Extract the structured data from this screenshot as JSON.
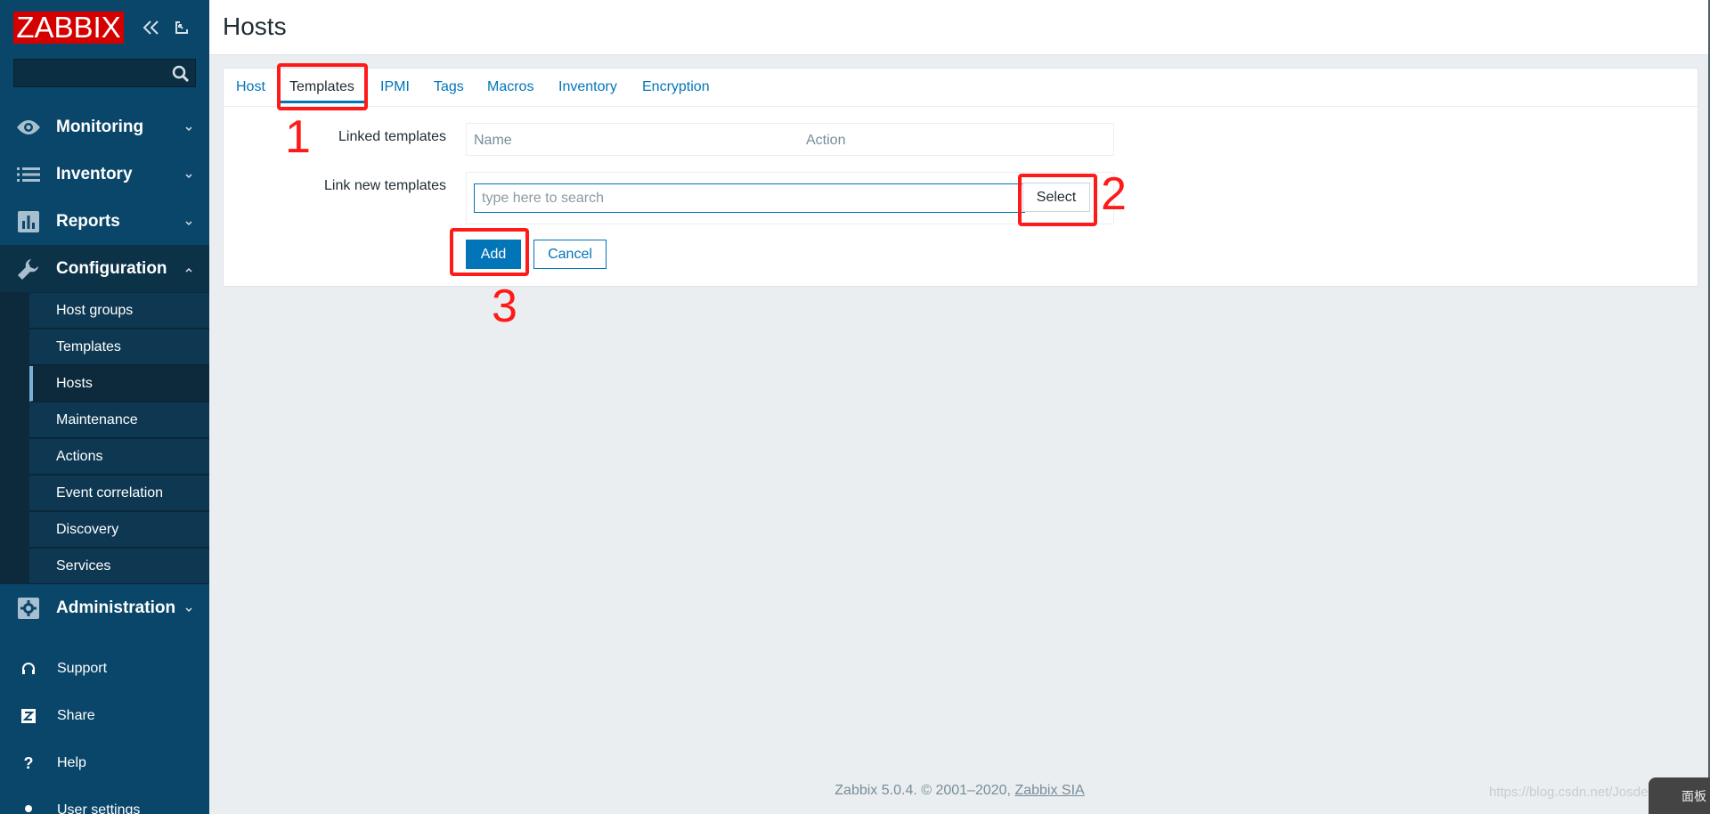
{
  "brand": {
    "logo": "ZABBIX",
    "color": "#d40000"
  },
  "sidebar": {
    "search_value": "",
    "menu": [
      {
        "label": "Monitoring",
        "icon": "eye-icon",
        "expanded": false
      },
      {
        "label": "Inventory",
        "icon": "list-icon",
        "expanded": false
      },
      {
        "label": "Reports",
        "icon": "bar-chart-icon",
        "expanded": false
      },
      {
        "label": "Configuration",
        "icon": "wrench-icon",
        "expanded": true
      },
      {
        "label": "Administration",
        "icon": "gear-icon",
        "expanded": false
      }
    ],
    "config_items": [
      {
        "label": "Host groups"
      },
      {
        "label": "Templates"
      },
      {
        "label": "Hosts",
        "active": true
      },
      {
        "label": "Maintenance"
      },
      {
        "label": "Actions"
      },
      {
        "label": "Event correlation"
      },
      {
        "label": "Discovery"
      },
      {
        "label": "Services"
      }
    ],
    "utility": [
      {
        "label": "Support",
        "icon": "headset-icon"
      },
      {
        "label": "Share",
        "icon": "share-z-icon"
      },
      {
        "label": "Help",
        "icon": "help-icon"
      },
      {
        "label": "User settings",
        "icon": "user-icon"
      }
    ]
  },
  "page": {
    "title": "Hosts"
  },
  "tabs": [
    {
      "label": "Host"
    },
    {
      "label": "Templates",
      "active": true
    },
    {
      "label": "IPMI"
    },
    {
      "label": "Tags"
    },
    {
      "label": "Macros"
    },
    {
      "label": "Inventory"
    },
    {
      "label": "Encryption"
    }
  ],
  "form": {
    "linked_templates_label": "Linked templates",
    "linked_columns": [
      "Name",
      "Action"
    ],
    "link_new_label": "Link new templates",
    "search_placeholder": "type here to search",
    "select_label": "Select",
    "add_label": "Add",
    "cancel_label": "Cancel"
  },
  "annotations": {
    "one": "1",
    "two": "2",
    "three": "3"
  },
  "footer": {
    "text": "Zabbix 5.0.4. © 2001–2020, ",
    "link": "Zabbix SIA"
  },
  "watermark": "https://blog.csdn.net/JosdeeT面板",
  "corner_button": "面板",
  "colors": {
    "accent": "#0275b8",
    "sidebar": "#0a466a",
    "annotation": "#ff1a1a"
  }
}
